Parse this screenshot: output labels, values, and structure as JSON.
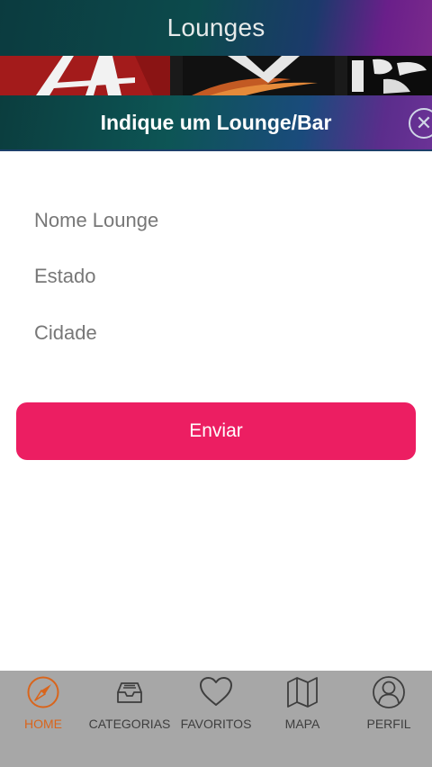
{
  "header": {
    "title": "Lounges"
  },
  "modal": {
    "title": "Indique um Lounge/Bar",
    "close_symbol": "✕",
    "fields": {
      "nome": {
        "placeholder": "Nome Lounge",
        "value": ""
      },
      "estado": {
        "placeholder": "Estado",
        "value": ""
      },
      "cidade": {
        "placeholder": "Cidade",
        "value": ""
      }
    },
    "submit_label": "Enviar"
  },
  "tabbar": {
    "items": [
      {
        "label": "HOME",
        "icon": "compass-icon",
        "active": true
      },
      {
        "label": "CATEGORIAS",
        "icon": "inbox-icon",
        "active": false
      },
      {
        "label": "FAVORITOS",
        "icon": "heart-icon",
        "active": false
      },
      {
        "label": "MAPA",
        "icon": "map-icon",
        "active": false
      },
      {
        "label": "PERFIL",
        "icon": "user-icon",
        "active": false
      }
    ]
  },
  "colors": {
    "accent": "#ec1e62",
    "active_tab": "#d9651c",
    "tab_inactive": "#3e3e3e",
    "tabbar_bg": "#a7a7a7"
  }
}
